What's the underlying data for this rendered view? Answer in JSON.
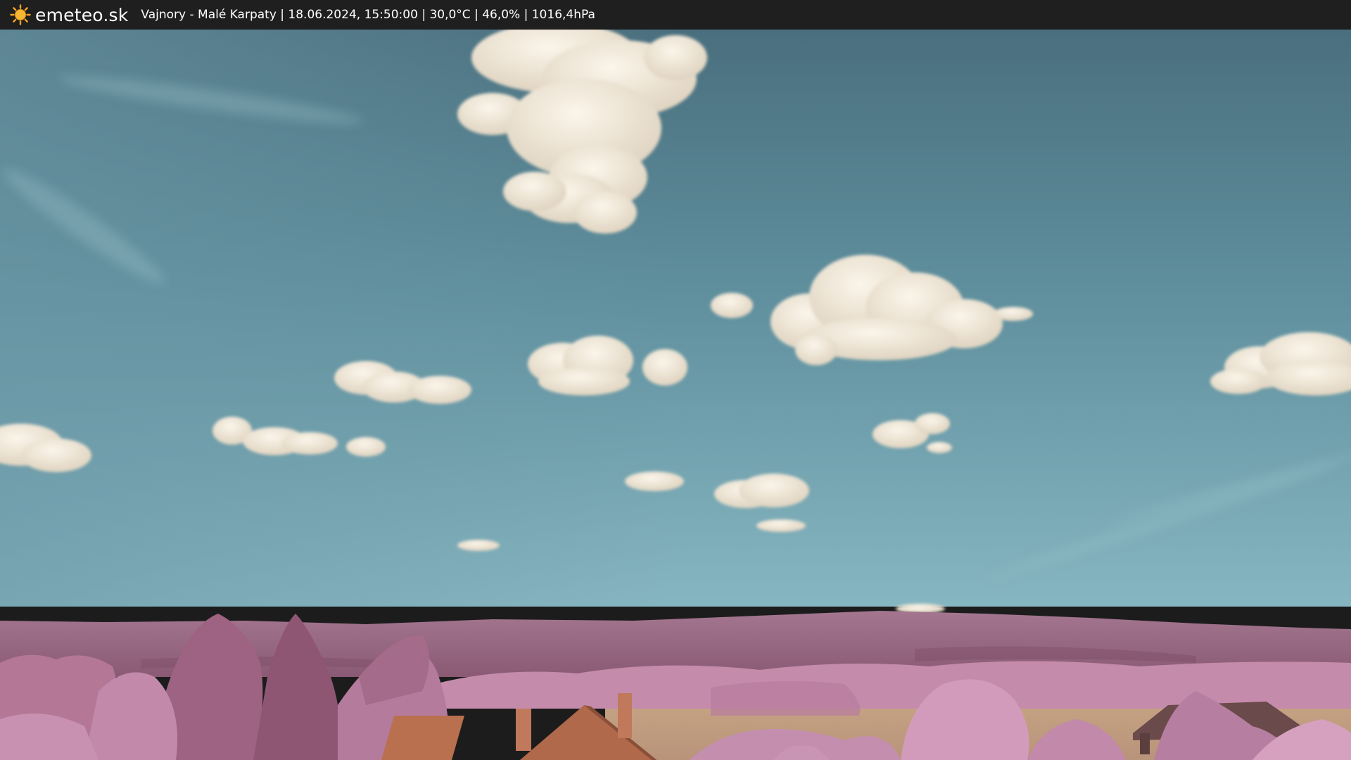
{
  "header": {
    "brand": "emeteo.sk",
    "brand_icon": "sun-icon",
    "status_line": "Vajnory - Malé Karpaty | 18.06.2024, 15:50:00 | 30,0°C | 46,0% | 1016,4hPa"
  },
  "colors": {
    "bar_background": "#1f1f1f",
    "sun": "#f5a623",
    "sky_top": "#4f7483",
    "sky_bottom": "#7fb2c0",
    "cloud": "#efe6d6",
    "hills": "#9a6882",
    "foliage": "#c890b0",
    "field": "#c9a582",
    "roof": "#b0694a"
  }
}
